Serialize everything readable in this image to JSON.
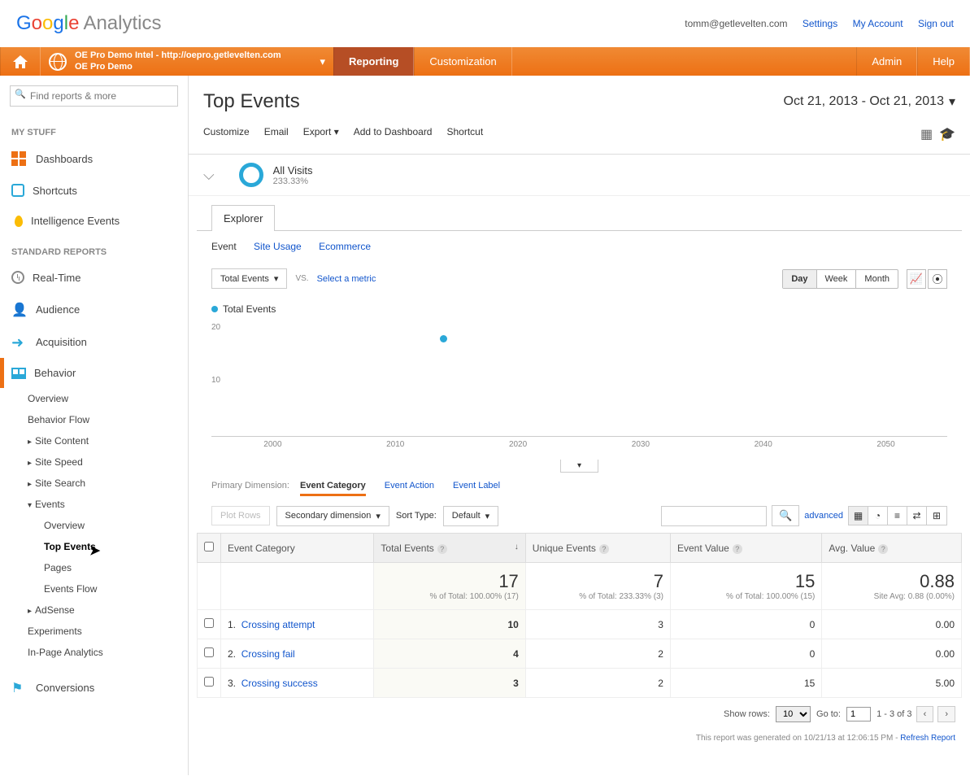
{
  "header": {
    "email": "tomm@getlevelten.com",
    "links": {
      "settings": "Settings",
      "account": "My Account",
      "signout": "Sign out"
    }
  },
  "nav": {
    "property_line1": "OE Pro Demo Intel - http://oepro.getlevelten.com",
    "property_line2": "OE Pro Demo",
    "reporting": "Reporting",
    "customization": "Customization",
    "admin": "Admin",
    "help": "Help"
  },
  "sidebar": {
    "search_placeholder": "Find reports & more",
    "my_stuff": "MY STUFF",
    "dashboards": "Dashboards",
    "shortcuts": "Shortcuts",
    "intelligence": "Intelligence Events",
    "standard_reports": "STANDARD REPORTS",
    "realtime": "Real-Time",
    "audience": "Audience",
    "acquisition": "Acquisition",
    "behavior": "Behavior",
    "conversions": "Conversions",
    "sub": {
      "overview": "Overview",
      "behavior_flow": "Behavior Flow",
      "site_content": "Site Content",
      "site_speed": "Site Speed",
      "site_search": "Site Search",
      "events": "Events",
      "ev_overview": "Overview",
      "ev_top": "Top Events",
      "ev_pages": "Pages",
      "ev_flow": "Events Flow",
      "adsense": "AdSense",
      "experiments": "Experiments",
      "inpage": "In-Page Analytics"
    }
  },
  "page": {
    "title": "Top Events",
    "date_range": "Oct 21, 2013 - Oct 21, 2013",
    "toolbar": {
      "customize": "Customize",
      "email": "Email",
      "export": "Export",
      "add": "Add to Dashboard",
      "shortcut": "Shortcut"
    },
    "segment": {
      "name": "All Visits",
      "pct": "233.33%"
    },
    "explorer": "Explorer",
    "subtabs": {
      "event": "Event",
      "site_usage": "Site Usage",
      "ecommerce": "Ecommerce"
    },
    "metric_sel": "Total Events",
    "vs": "VS.",
    "select_metric": "Select a metric",
    "time": {
      "day": "Day",
      "week": "Week",
      "month": "Month"
    },
    "chart_legend": "Total Events",
    "dim_label": "Primary Dimension:",
    "dim_active": "Event Category",
    "dim_action": "Event Action",
    "dim_label2": "Event Label",
    "plot_rows": "Plot Rows",
    "sec_dim": "Secondary dimension",
    "sort_type": "Sort Type:",
    "sort_default": "Default",
    "advanced": "advanced",
    "cols": {
      "cat": "Event Category",
      "total": "Total Events",
      "unique": "Unique Events",
      "value": "Event Value",
      "avg": "Avg. Value"
    },
    "totals": {
      "total": "17",
      "total_sub": "% of Total: 100.00% (17)",
      "unique": "7",
      "unique_sub": "% of Total: 233.33% (3)",
      "value": "15",
      "value_sub": "% of Total: 100.00% (15)",
      "avg": "0.88",
      "avg_sub": "Site Avg: 0.88 (0.00%)"
    },
    "rows": [
      {
        "n": "1.",
        "cat": "Crossing attempt",
        "total": "10",
        "unique": "3",
        "value": "0",
        "avg": "0.00"
      },
      {
        "n": "2.",
        "cat": "Crossing fail",
        "total": "4",
        "unique": "2",
        "value": "0",
        "avg": "0.00"
      },
      {
        "n": "3.",
        "cat": "Crossing success",
        "total": "3",
        "unique": "2",
        "value": "15",
        "avg": "5.00"
      }
    ],
    "pager": {
      "show_rows": "Show rows:",
      "rows": "10",
      "goto": "Go to:",
      "page": "1",
      "range": "1 - 3 of 3"
    },
    "footer": "This report was generated on 10/21/13 at 12:06:15 PM - ",
    "refresh": "Refresh Report"
  },
  "chart_data": {
    "type": "scatter",
    "title": "Total Events",
    "x": [
      2014
    ],
    "y": [
      17
    ],
    "x_ticks": [
      2000,
      2010,
      2020,
      2030,
      2040,
      2050
    ],
    "y_ticks": [
      10,
      20
    ],
    "xlim": [
      1995,
      2060
    ],
    "ylim": [
      0,
      22
    ]
  }
}
